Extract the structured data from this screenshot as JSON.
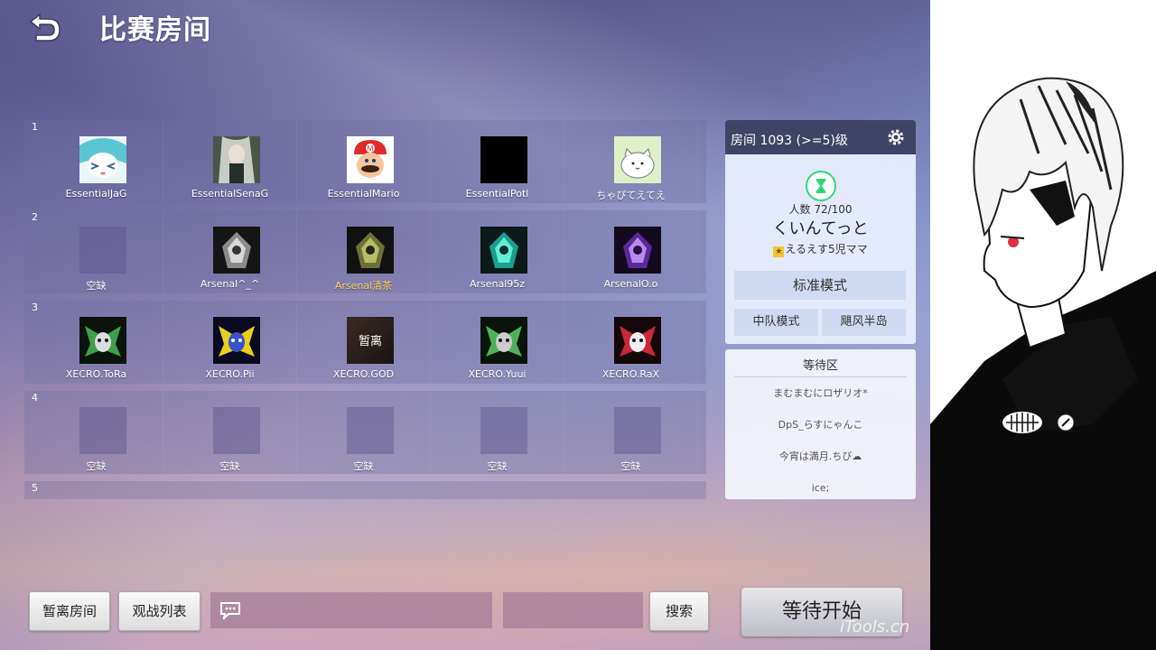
{
  "header": {
    "title": "比赛房间"
  },
  "teams": [
    {
      "num": "1",
      "players": [
        {
          "name": "EssentialJaG",
          "avatar": "miku"
        },
        {
          "name": "EssentialSenaG",
          "avatar": "anime-girl"
        },
        {
          "name": "EssentialMario",
          "avatar": "mario"
        },
        {
          "name": "EssentialPotl",
          "avatar": "black"
        },
        {
          "name": "ちゃぴてえてえ",
          "avatar": "cat"
        }
      ]
    },
    {
      "num": "2",
      "players": [
        {
          "name": "空缺",
          "avatar": "empty"
        },
        {
          "name": "Arsenal^_^",
          "avatar": "mech-gray"
        },
        {
          "name": "Arsenal清茶",
          "avatar": "mech-green",
          "highlight": true
        },
        {
          "name": "Arsenal95z",
          "avatar": "mech-teal"
        },
        {
          "name": "ArsenalO.o",
          "avatar": "mech-purple"
        }
      ]
    },
    {
      "num": "3",
      "players": [
        {
          "name": "XECRO.ToRa",
          "avatar": "hero-green"
        },
        {
          "name": "XECRO.Pii",
          "avatar": "hero-yellow"
        },
        {
          "name": "XECRO.GOD",
          "avatar": "text-avatar",
          "avatar_text": "暂离"
        },
        {
          "name": "XECRO.Yuui",
          "avatar": "hero-green"
        },
        {
          "name": "XECRO.RaX",
          "avatar": "hero-red"
        }
      ]
    },
    {
      "num": "4",
      "players": [
        {
          "name": "空缺",
          "avatar": "empty"
        },
        {
          "name": "空缺",
          "avatar": "empty"
        },
        {
          "name": "空缺",
          "avatar": "empty"
        },
        {
          "name": "空缺",
          "avatar": "empty"
        },
        {
          "name": "空缺",
          "avatar": "empty"
        }
      ]
    },
    {
      "num": "5",
      "players": []
    }
  ],
  "room": {
    "title": "房间 1093 (>=5)级",
    "count_label": "人数",
    "count": "72/100",
    "host": "くいんてっと",
    "sub_badge": "★",
    "sub": "えるえす5児ママ",
    "mode": "标准模式",
    "team_mode": "中队模式",
    "map": "飓风半岛"
  },
  "waiting": {
    "title": "等待区",
    "items": [
      "まむまむにロザリオ*",
      "DpS_らすにゃんこ",
      "今宵は満月.ちび☁",
      "ice;"
    ]
  },
  "bottom": {
    "leave": "暂离房间",
    "spectators": "观战列表",
    "search": "搜索",
    "start": "等待开始"
  },
  "watermark": "iTools.cn",
  "icons": [
    "back-arrow-icon",
    "gear-icon",
    "hourglass-icon",
    "chat-bubble-icon",
    "star-icon"
  ]
}
